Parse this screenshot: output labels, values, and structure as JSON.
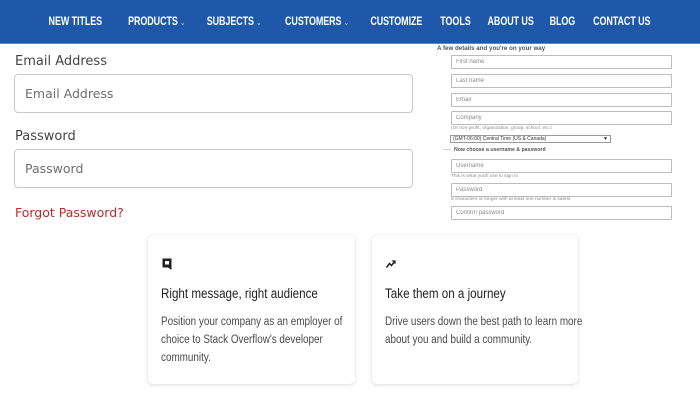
{
  "nav": {
    "items": [
      {
        "label": "NEW TITLES",
        "dropdown": false
      },
      {
        "label": "PRODUCTS",
        "dropdown": true
      },
      {
        "label": "SUBJECTS",
        "dropdown": true
      },
      {
        "label": "CUSTOMERS",
        "dropdown": true
      },
      {
        "label": "CUSTOMIZE",
        "dropdown": false
      },
      {
        "label": "TOOLS",
        "dropdown": false
      },
      {
        "label": "ABOUT US",
        "dropdown": false
      },
      {
        "label": "BLOG",
        "dropdown": false
      },
      {
        "label": "CONTACT US",
        "dropdown": false
      }
    ],
    "background_color": "#1f58a8"
  },
  "login": {
    "email_label": "Email Address",
    "email_placeholder": "Email Address",
    "password_label": "Password",
    "password_placeholder": "Password",
    "forgot_link": "Forgot Password?",
    "forgot_color": "#c0282d"
  },
  "signup": {
    "heading": "A few details and you're on your way",
    "first_name_placeholder": "First name",
    "last_name_placeholder": "Last name",
    "email_placeholder": "Email",
    "company_placeholder": "Company",
    "company_hint": "(Or non-profit, organization, group, school, etc.)",
    "timezone_selected": "(GMT-06:00) Central Time (US & Canada)",
    "account_subheading": "Now choose a username & password",
    "username_placeholder": "Username",
    "username_hint": "This is what you'll use to sign in",
    "password_placeholder": "Password",
    "password_hint": "8 characters or longer with at least one number is safest",
    "confirm_placeholder": "Confirm password"
  },
  "cards": [
    {
      "icon": "message-square-icon",
      "title": "Right message, right audience",
      "body_lines": [
        "Position your company as an employer of",
        "choice to Stack Overflow's developer",
        "community."
      ]
    },
    {
      "icon": "trending-up-icon",
      "title": "Take them on a journey",
      "body_lines": [
        "Drive users down the best path to learn more",
        "about you and build a community."
      ]
    }
  ]
}
